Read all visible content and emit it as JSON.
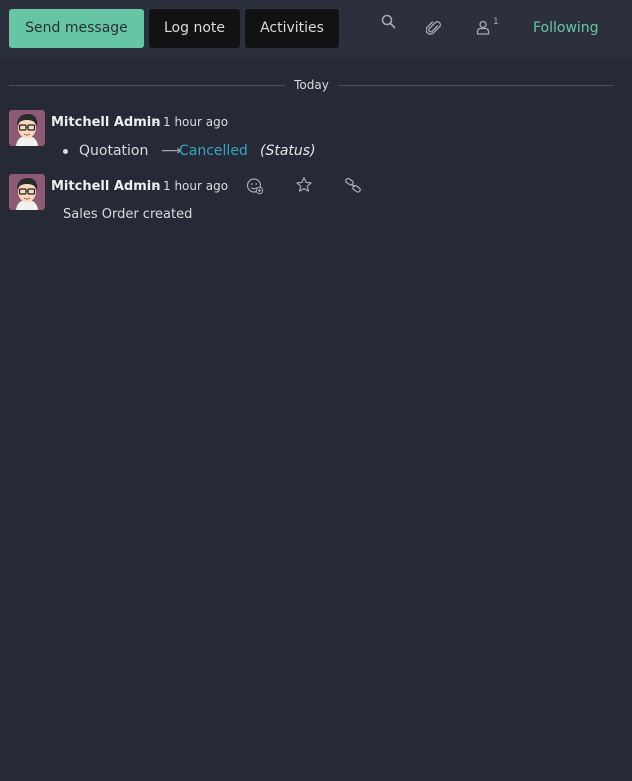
{
  "composer": {
    "send_message_label": "Send message",
    "log_note_label": "Log note",
    "activities_label": "Activities"
  },
  "topbar": {
    "follower_count": "1",
    "following_label": "Following"
  },
  "separator": {
    "label": "Today"
  },
  "messages": [
    {
      "author": "Mitchell Admin",
      "dash": "-",
      "time": "1 hour ago",
      "tracking": {
        "field_name": "Quotation",
        "arrow": "⟶",
        "new_value": "Cancelled",
        "field_desc": "(Status)"
      }
    },
    {
      "author": "Mitchell Admin",
      "dash": "-",
      "time": "1 hour ago",
      "body": "Sales Order created"
    }
  ],
  "colors": {
    "background": "#262a36",
    "topbar": "#2c303d",
    "primary": "#66c6a4",
    "link": "#3aa3c4"
  }
}
